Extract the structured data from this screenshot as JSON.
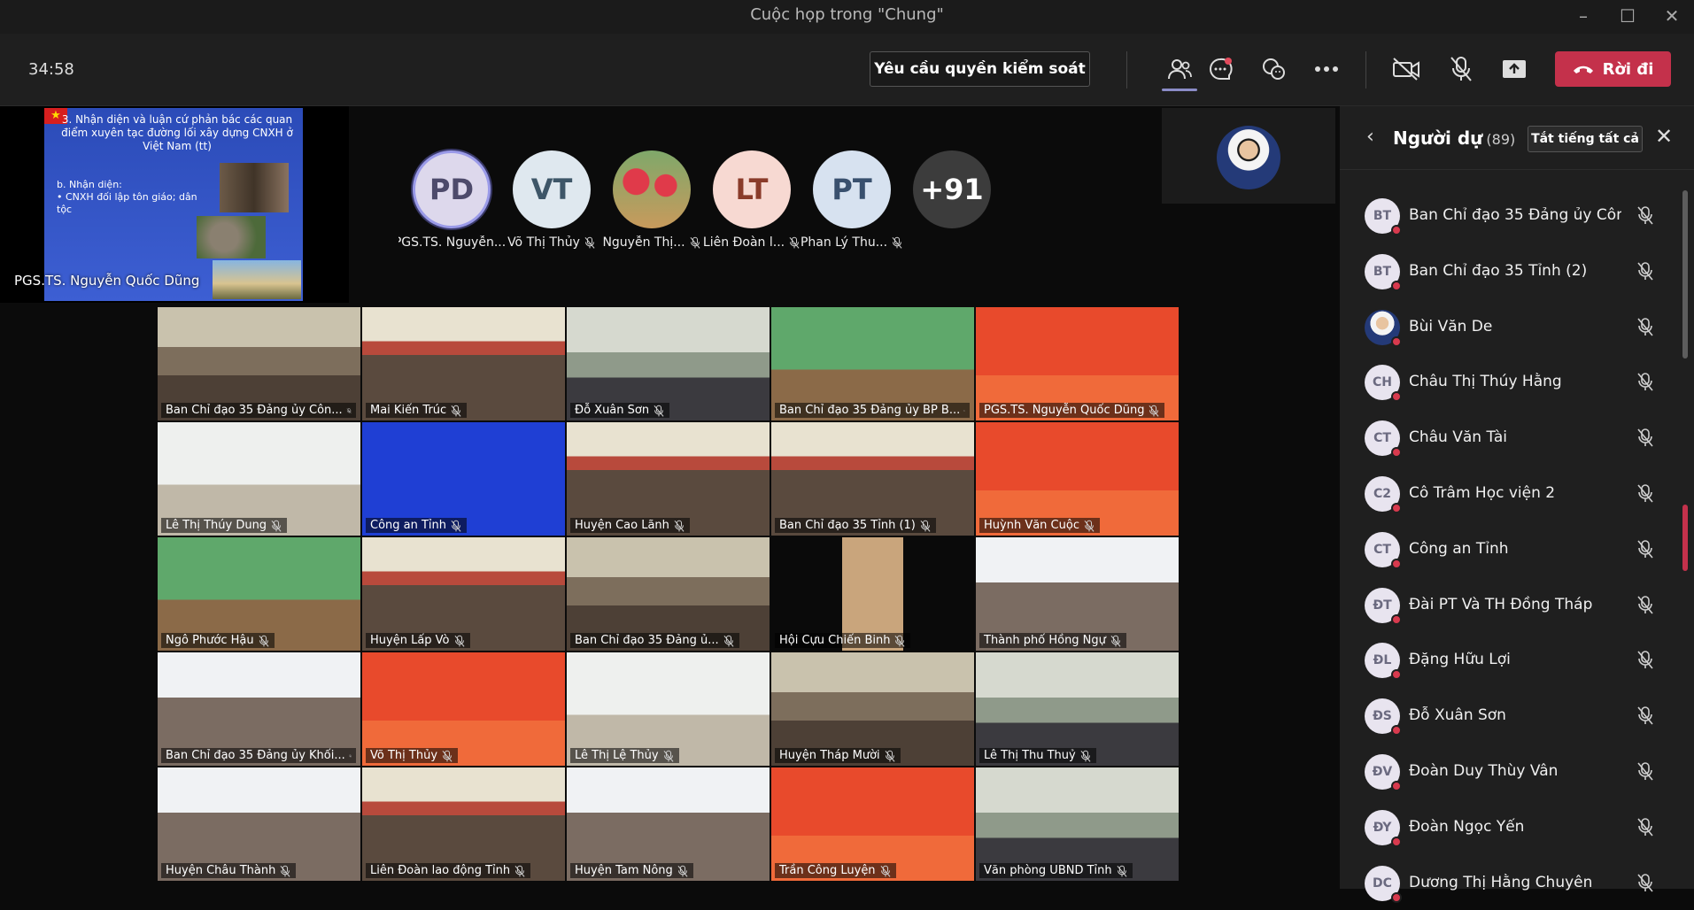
{
  "window": {
    "title": "Cuộc họp trong \"Chung\""
  },
  "toolbar": {
    "timer": "34:58",
    "request_control": "Yêu cầu quyền kiểm soát",
    "leave": "Rời đi",
    "icons": [
      "people-icon",
      "chat-icon",
      "reactions-icon",
      "more-icon",
      "camera-off-icon",
      "mic-off-icon",
      "share-icon"
    ]
  },
  "slide": {
    "title": "3. Nhận diện và luận cứ phản bác các quan điểm xuyên tạc đường lối xây dựng CNXH ở Việt Nam (tt)",
    "line1": "b. Nhận diện:",
    "line2": "• CNXH đối lập tôn giáo; dân tộc",
    "presenter": "PGS.TS. Nguyễn Quốc Dũng"
  },
  "avatars": [
    {
      "initials": "PD",
      "name": "PGS.TS. Nguyễn...",
      "bg": "#ddd8ec",
      "fg": "#4d4a6b"
    },
    {
      "initials": "VT",
      "name": "Võ Thị Thủy",
      "bg": "#dfe8ef",
      "fg": "#3e5668"
    },
    {
      "initials": "",
      "name": "Nguyễn Thị...",
      "bg": "#c2985e",
      "fg": "#fff"
    },
    {
      "initials": "LT",
      "name": "Liên Đoàn l...",
      "bg": "#f7d9d2",
      "fg": "#8a3b2a"
    },
    {
      "initials": "PT",
      "name": "Phan Lý Thu...",
      "bg": "#d7e2f0",
      "fg": "#39506e"
    },
    {
      "initials": "+91",
      "name": "",
      "bg": "#3c3c3c",
      "fg": "#fff"
    }
  ],
  "tiles": [
    {
      "label": "Ban Chỉ đạo 35 Đảng ủy Côn...",
      "bg": "bg-room"
    },
    {
      "label": "Mai Kiến Trúc",
      "bg": "bg-hall"
    },
    {
      "label": "Đỗ Xuân Sơn",
      "bg": "bg-room2"
    },
    {
      "label": "Ban Chỉ đạo 35 Đảng ủy BP B...",
      "bg": "bg-green"
    },
    {
      "label": "PGS.TS. Nguyễn Quốc Dũng",
      "bg": "bg-red"
    },
    {
      "label": "Lê Thị Thúy Dung",
      "bg": "bg-white"
    },
    {
      "label": "Công an Tỉnh",
      "bg": "bg-blue"
    },
    {
      "label": "Huyện Cao Lãnh",
      "bg": "bg-hall"
    },
    {
      "label": "Ban Chỉ đạo 35 Tỉnh (1)",
      "bg": "bg-hall"
    },
    {
      "label": "Huỳnh Văn Cuộc",
      "bg": "bg-red"
    },
    {
      "label": "Ngô Phước Hậu",
      "bg": "bg-green"
    },
    {
      "label": "Huyện Lấp Vò",
      "bg": "bg-hall"
    },
    {
      "label": "Ban Chỉ đạo 35 Đảng ủ...",
      "bg": "bg-room"
    },
    {
      "label": "Hội Cựu Chiến Binh",
      "bg": "bg-dark"
    },
    {
      "label": "Thành phố Hồng Ngự",
      "bg": "bg-class"
    },
    {
      "label": "Ban Chỉ đạo 35 Đảng ủy Khối...",
      "bg": "bg-class"
    },
    {
      "label": "Võ Thị Thủy",
      "bg": "bg-red"
    },
    {
      "label": "Lê Thị Lệ Thủy",
      "bg": "bg-white"
    },
    {
      "label": "Huyện Tháp Mười",
      "bg": "bg-room"
    },
    {
      "label": "Lê Thị Thu Thuỷ",
      "bg": "bg-room2"
    },
    {
      "label": "Huyện Châu Thành",
      "bg": "bg-class"
    },
    {
      "label": "Liên Đoàn lao động Tỉnh",
      "bg": "bg-hall"
    },
    {
      "label": "Huyện Tam Nông",
      "bg": "bg-class"
    },
    {
      "label": "Trần Công Luyện",
      "bg": "bg-red"
    },
    {
      "label": "Văn phòng UBND Tỉnh",
      "bg": "bg-room2"
    }
  ],
  "panel": {
    "title": "Người dự",
    "count": "(89)",
    "mute_all": "Tắt tiếng tất cả",
    "participants": [
      {
        "initials": "BT",
        "name": "Ban Chỉ đạo 35 Đảng ủy Côn..."
      },
      {
        "initials": "BT",
        "name": "Ban Chỉ đạo 35 Tỉnh (2)"
      },
      {
        "initials": "",
        "name": "Bùi Văn De"
      },
      {
        "initials": "CH",
        "name": "Châu Thị Thúy Hằng"
      },
      {
        "initials": "CT",
        "name": "Châu Văn Tài"
      },
      {
        "initials": "C2",
        "name": "Cô Trâm Học viện 2"
      },
      {
        "initials": "CT",
        "name": "Công an Tỉnh"
      },
      {
        "initials": "ĐT",
        "name": "Đài PT Và TH Đồng Tháp"
      },
      {
        "initials": "ĐL",
        "name": "Đặng Hữu Lợi"
      },
      {
        "initials": "ĐS",
        "name": "Đỗ Xuân Sơn"
      },
      {
        "initials": "ĐV",
        "name": "Đoàn Duy Thùy Vân"
      },
      {
        "initials": "ĐY",
        "name": "Đoàn Ngọc Yến"
      },
      {
        "initials": "DC",
        "name": "Dương Thị Hằng Chuyên"
      }
    ]
  }
}
